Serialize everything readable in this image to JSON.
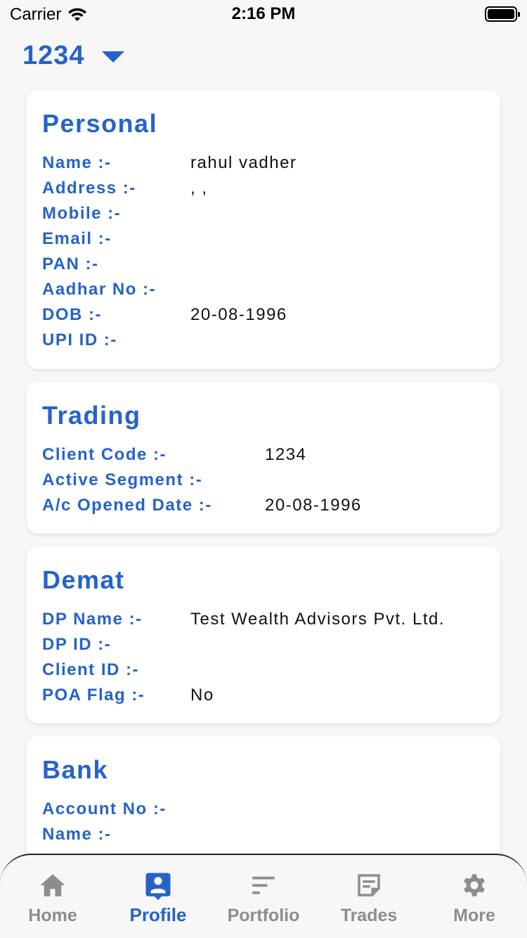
{
  "status": {
    "carrier": "Carrier",
    "time": "2:16 PM"
  },
  "account": {
    "number": "1234"
  },
  "personal": {
    "title": "Personal",
    "rows": [
      {
        "label": "Name :-",
        "value": "rahul vadher"
      },
      {
        "label": "Address :-",
        "value": ", ,"
      },
      {
        "label": "Mobile :-",
        "value": ""
      },
      {
        "label": "Email :-",
        "value": ""
      },
      {
        "label": "PAN :-",
        "value": ""
      },
      {
        "label": "Aadhar No :-",
        "value": ""
      },
      {
        "label": "DOB :-",
        "value": "20-08-1996"
      },
      {
        "label": "UPI ID :-",
        "value": ""
      }
    ]
  },
  "trading": {
    "title": "Trading",
    "rows": [
      {
        "label": "Client Code :-",
        "value": "1234"
      },
      {
        "label": "Active Segment :-",
        "value": ""
      },
      {
        "label": "A/c Opened Date :-",
        "value": "20-08-1996"
      }
    ]
  },
  "demat": {
    "title": "Demat",
    "rows": [
      {
        "label": "DP Name :-",
        "value": "Test Wealth Advisors Pvt. Ltd."
      },
      {
        "label": "DP ID :-",
        "value": ""
      },
      {
        "label": "Client ID :-",
        "value": ""
      },
      {
        "label": "POA Flag :-",
        "value": "No"
      }
    ]
  },
  "bank": {
    "title": "Bank",
    "rows": [
      {
        "label": "Account No :-",
        "value": ""
      },
      {
        "label": "Name :-",
        "value": ""
      }
    ]
  },
  "tabs": [
    {
      "label": "Home",
      "icon": "home-icon",
      "active": false
    },
    {
      "label": "Profile",
      "icon": "profile-icon",
      "active": true
    },
    {
      "label": "Portfolio",
      "icon": "portfolio-icon",
      "active": false
    },
    {
      "label": "Trades",
      "icon": "trades-icon",
      "active": false
    },
    {
      "label": "More",
      "icon": "gear-icon",
      "active": false
    }
  ],
  "colors": {
    "accent": "#2563c9",
    "inactive": "#8d8d8d",
    "background": "#f7f7f7"
  }
}
